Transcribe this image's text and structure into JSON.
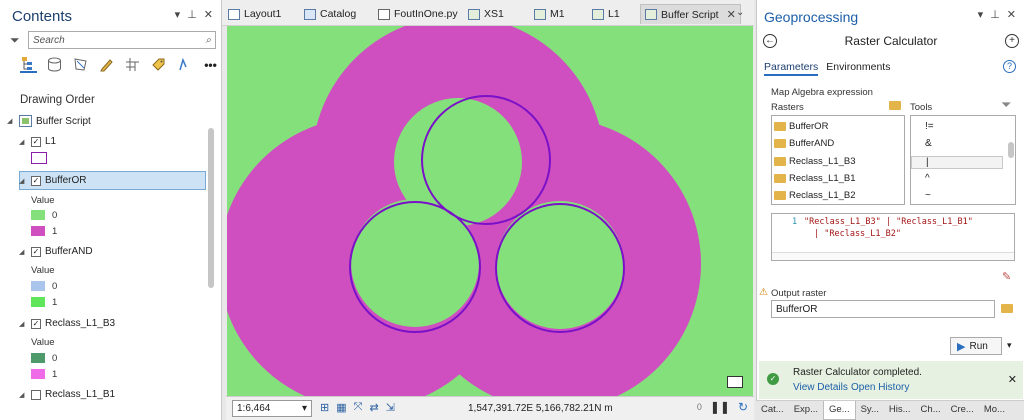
{
  "colors": {
    "map_background": "#84e07a",
    "buffer_or": "#cf4fc0",
    "circle_outline": "#7a10c8",
    "accent": "#1c5fa8",
    "bufferor_swatch_0": "#84e07a",
    "bufferor_swatch_1": "#cf4fc0",
    "bufferand_swatch_0": "#a9c5ec",
    "bufferand_swatch_1": "#5ee55a",
    "reclass_swatch_0": "#4f9a6a",
    "reclass_swatch_1": "#f06be8"
  },
  "contents": {
    "title": "Contents",
    "search_placeholder": "Search",
    "drawing_order_heading": "Drawing Order",
    "map_name": "Buffer Script",
    "layers": [
      {
        "name": "L1"
      },
      {
        "name": "BufferOR",
        "legend_title": "Value",
        "values": [
          "0",
          "1"
        ]
      },
      {
        "name": "BufferAND",
        "legend_title": "Value",
        "values": [
          "0",
          "1"
        ]
      },
      {
        "name": "Reclass_L1_B3",
        "legend_title": "Value",
        "values": [
          "0",
          "1"
        ]
      },
      {
        "name": "Reclass_L1_B1"
      }
    ]
  },
  "tabs": [
    {
      "label": "Layout1",
      "icon": "layout-icon"
    },
    {
      "label": "Catalog",
      "icon": "catalog-icon"
    },
    {
      "label": "FoutInOne.py",
      "icon": "script-icon"
    },
    {
      "label": "XS1",
      "icon": "map-icon"
    },
    {
      "label": "M1",
      "icon": "map-icon"
    },
    {
      "label": "L1",
      "icon": "map-icon"
    },
    {
      "label": "Buffer Script",
      "icon": "map-icon"
    }
  ],
  "statusbar": {
    "scale": "1:6,464",
    "coordinates": "1,547,391.72E 5,166,782.21N m",
    "drawing_count": "0"
  },
  "geoprocessing": {
    "title": "Geoprocessing",
    "tool_title": "Raster Calculator",
    "tab_parameters": "Parameters",
    "tab_environments": "Environments",
    "map_algebra_label": "Map Algebra expression",
    "rasters_label": "Rasters",
    "tools_label": "Tools",
    "rasters": [
      "BufferOR",
      "BufferAND",
      "Reclass_L1_B3",
      "Reclass_L1_B1",
      "Reclass_L1_B2"
    ],
    "tools": [
      "!=",
      "&",
      "|",
      "^",
      "~"
    ],
    "expression_line_number": "1",
    "expression_line1": "\"Reclass_L1_B3\" | \"Reclass_L1_B1\"",
    "expression_line2": "| \"Reclass_L1_B2\"",
    "output_label": "Output raster",
    "output_value": "BufferOR",
    "run_label": "Run",
    "status_message": "Raster Calculator completed.",
    "view_details": "View Details",
    "open_history": "Open History"
  },
  "bottom_tabs": [
    "Cat...",
    "Exp...",
    "Ge...",
    "Sy...",
    "His...",
    "Ch...",
    "Cre...",
    "Mo..."
  ]
}
